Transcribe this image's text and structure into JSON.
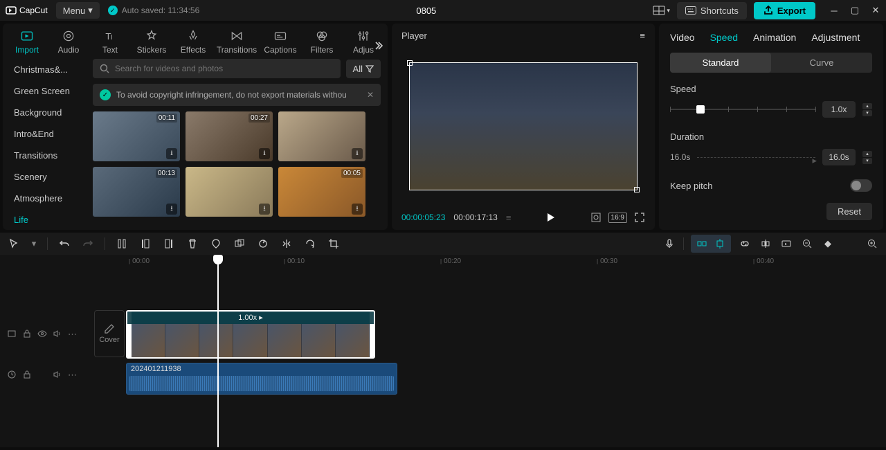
{
  "titlebar": {
    "app_name": "CapCut",
    "menu_label": "Menu",
    "autosave_label": "Auto saved: 11:34:56",
    "project_title": "0805",
    "shortcuts_label": "Shortcuts",
    "export_label": "Export"
  },
  "media_tabs": [
    {
      "label": "Import",
      "active": true
    },
    {
      "label": "Audio"
    },
    {
      "label": "Text"
    },
    {
      "label": "Stickers"
    },
    {
      "label": "Effects"
    },
    {
      "label": "Transitions"
    },
    {
      "label": "Captions"
    },
    {
      "label": "Filters"
    },
    {
      "label": "Adjus"
    }
  ],
  "sidebar_items": [
    {
      "label": "Christmas&..."
    },
    {
      "label": "Green Screen"
    },
    {
      "label": "Background"
    },
    {
      "label": "Intro&End"
    },
    {
      "label": "Transitions"
    },
    {
      "label": "Scenery"
    },
    {
      "label": "Atmosphere"
    },
    {
      "label": "Life",
      "active": true
    }
  ],
  "search": {
    "placeholder": "Search for videos and photos",
    "all_label": "All"
  },
  "banner": {
    "text": "To avoid copyright infringement, do not export materials withou"
  },
  "thumbs": [
    {
      "dur": "00:11"
    },
    {
      "dur": "00:27"
    },
    {
      "dur": ""
    },
    {
      "dur": "00:13"
    },
    {
      "dur": ""
    },
    {
      "dur": "00:05"
    }
  ],
  "player": {
    "title": "Player",
    "current": "00:00:05:23",
    "total": "00:00:17:13",
    "ratio": "16:9"
  },
  "prop_tabs": [
    {
      "label": "Video"
    },
    {
      "label": "Speed",
      "active": true
    },
    {
      "label": "Animation"
    },
    {
      "label": "Adjustment"
    }
  ],
  "speed_panel": {
    "sub_tabs": [
      {
        "label": "Standard",
        "active": true
      },
      {
        "label": "Curve"
      }
    ],
    "speed_label": "Speed",
    "speed_value": "1.0x",
    "duration_label": "Duration",
    "duration_left": "16.0s",
    "duration_value": "16.0s",
    "keep_pitch_label": "Keep pitch",
    "reset_label": "Reset"
  },
  "ruler_marks": [
    "00:00",
    "00:10",
    "00:20",
    "00:30",
    "00:40"
  ],
  "timeline": {
    "cover_label": "Cover",
    "clip_speed": "1.00x ▸",
    "audio_label": "202401211938"
  }
}
